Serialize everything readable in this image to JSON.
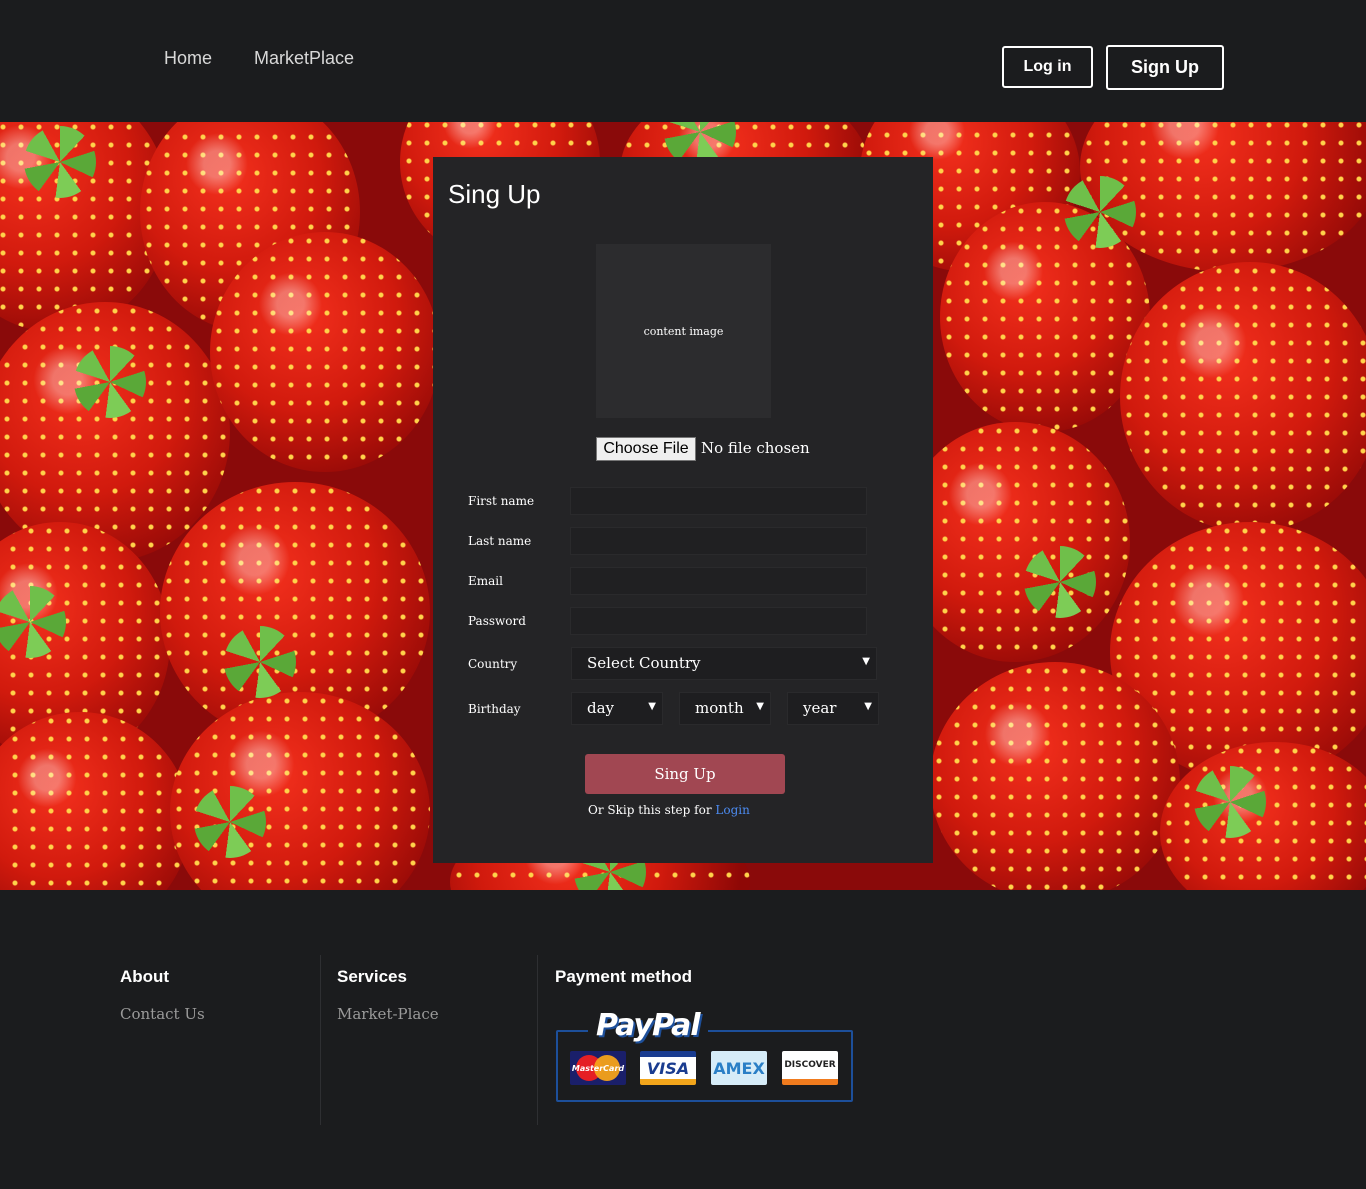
{
  "header": {
    "nav": [
      "Home",
      "MarketPlace"
    ],
    "login_label": "Log in",
    "signup_label": "Sign Up"
  },
  "form": {
    "title": "Sing Up",
    "image_placeholder": "content image",
    "file_button": "Choose File",
    "file_status": "No file chosen",
    "labels": {
      "first_name": "First name",
      "last_name": "Last name",
      "email": "Email",
      "password": "Password",
      "country": "Country",
      "birthday": "Birthday"
    },
    "country_select": "Select Country",
    "birthday_selects": {
      "day": "day",
      "month": "month",
      "year": "year"
    },
    "submit_label": "Sing Up",
    "skip_text": "Or Skip this step for",
    "skip_link": "Login"
  },
  "footer": {
    "about": {
      "title": "About",
      "links": [
        "Contact Us"
      ]
    },
    "services": {
      "title": "Services",
      "links": [
        "Market-Place"
      ]
    },
    "payment": {
      "title": "Payment method",
      "brand": "PayPal",
      "cards": [
        "MasterCard",
        "VISA",
        "AMEX",
        "DISCOVER"
      ]
    }
  },
  "colors": {
    "background": "#1b1c1e",
    "card": "#242426",
    "submit": "#a14752",
    "link": "#4c8bf0",
    "paypal_blue": "#1d4f9a"
  }
}
